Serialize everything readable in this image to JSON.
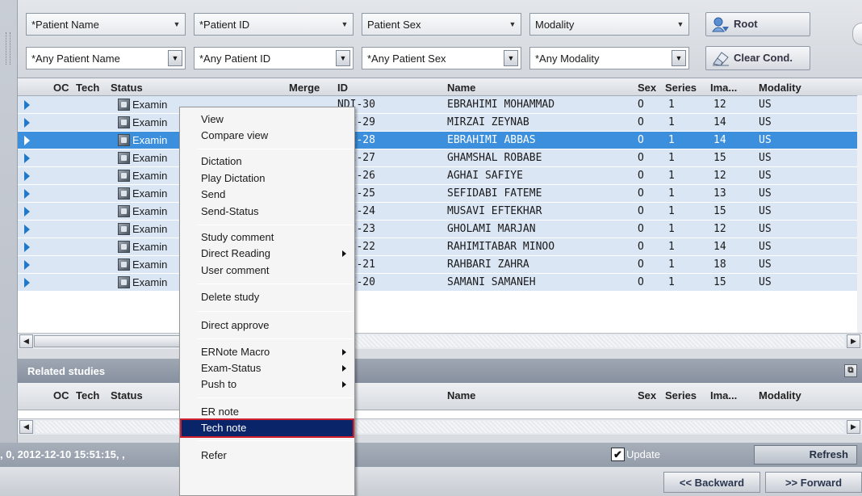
{
  "filters": {
    "row1": [
      {
        "label": "*Patient Name"
      },
      {
        "label": "*Patient ID"
      },
      {
        "label": "Patient Sex"
      },
      {
        "label": "Modality"
      }
    ],
    "row2": [
      {
        "label": "*Any Patient Name"
      },
      {
        "label": "*Any Patient ID"
      },
      {
        "label": "*Any Patient Sex"
      },
      {
        "label": "*Any Modality"
      }
    ],
    "root_button": "Root",
    "clear_button": "Clear Cond."
  },
  "grid": {
    "columns": {
      "oc": "OC",
      "tech": "Tech",
      "status": "Status",
      "merge": "Merge",
      "id": "ID",
      "name": "Name",
      "sex": "Sex",
      "series": "Series",
      "images": "Ima...",
      "modality": "Modality"
    },
    "rows": [
      {
        "status": "Examin",
        "id": "NDI-30",
        "name": "EBRAHIMI MOHAMMAD",
        "sex": "O",
        "series": "1",
        "images": "12",
        "modality": "US",
        "selected": false
      },
      {
        "status": "Examin",
        "id": "NDI-29",
        "name": "MIRZAI ZEYNAB",
        "sex": "O",
        "series": "1",
        "images": "14",
        "modality": "US",
        "selected": false
      },
      {
        "status": "Examin",
        "id": "NDI-28",
        "name": "EBRAHIMI ABBAS",
        "sex": "O",
        "series": "1",
        "images": "14",
        "modality": "US",
        "selected": true
      },
      {
        "status": "Examin",
        "id": "NDI-27",
        "name": "GHAMSHAL ROBABE",
        "sex": "O",
        "series": "1",
        "images": "15",
        "modality": "US",
        "selected": false
      },
      {
        "status": "Examin",
        "id": "NDI-26",
        "name": "AGHAI SAFIYE",
        "sex": "O",
        "series": "1",
        "images": "12",
        "modality": "US",
        "selected": false
      },
      {
        "status": "Examin",
        "id": "NDI-25",
        "name": "SEFIDABI FATEME",
        "sex": "O",
        "series": "1",
        "images": "13",
        "modality": "US",
        "selected": false
      },
      {
        "status": "Examin",
        "id": "NDI-24",
        "name": "MUSAVI EFTEKHAR",
        "sex": "O",
        "series": "1",
        "images": "15",
        "modality": "US",
        "selected": false
      },
      {
        "status": "Examin",
        "id": "NDI-23",
        "name": "GHOLAMI MARJAN",
        "sex": "O",
        "series": "1",
        "images": "12",
        "modality": "US",
        "selected": false
      },
      {
        "status": "Examin",
        "id": "NDI-22",
        "name": "RAHIMITABAR MINOO",
        "sex": "O",
        "series": "1",
        "images": "14",
        "modality": "US",
        "selected": false
      },
      {
        "status": "Examin",
        "id": "NDI-21",
        "name": "RAHBARI ZAHRA",
        "sex": "O",
        "series": "1",
        "images": "18",
        "modality": "US",
        "selected": false
      },
      {
        "status": "Examin",
        "id": "NDI-20",
        "name": "SAMANI SAMANEH",
        "sex": "O",
        "series": "1",
        "images": "15",
        "modality": "US",
        "selected": false
      }
    ]
  },
  "related": {
    "title": "Related studies",
    "columns": {
      "oc": "OC",
      "tech": "Tech",
      "status": "Status",
      "name": "Name",
      "sex": "Sex",
      "series": "Series",
      "images": "Ima...",
      "modality": "Modality"
    }
  },
  "status_bar": {
    "text": ", 0, 2012-12-10 15:51:15, ,",
    "update_label": "Update",
    "refresh_label": "Refresh"
  },
  "nav": {
    "backward_label": "<< Backward",
    "forward_label": ">> Forward"
  },
  "context_menu": {
    "items": [
      {
        "label": "View"
      },
      {
        "label": "Compare view"
      },
      {
        "label": "Dictation"
      },
      {
        "label": "Play Dictation"
      },
      {
        "label": "Send"
      },
      {
        "label": "Send-Status"
      },
      {
        "label": "Study comment"
      },
      {
        "label": "Direct Reading",
        "submenu": true
      },
      {
        "label": "User comment"
      },
      {
        "label": "Delete study"
      },
      {
        "label": "Direct approve"
      },
      {
        "label": "ERNote Macro",
        "submenu": true
      },
      {
        "label": "Exam-Status",
        "submenu": true
      },
      {
        "label": "Push to",
        "submenu": true
      },
      {
        "label": "ER note"
      },
      {
        "label": "Tech note",
        "highlighted": true
      },
      {
        "label": "Refer"
      }
    ]
  },
  "colors": {
    "row_bg": "#dbe6f5",
    "selected_row": "#3b8fdc",
    "menu_highlight": "#0a246a",
    "highlight_border": "#d0202e"
  }
}
